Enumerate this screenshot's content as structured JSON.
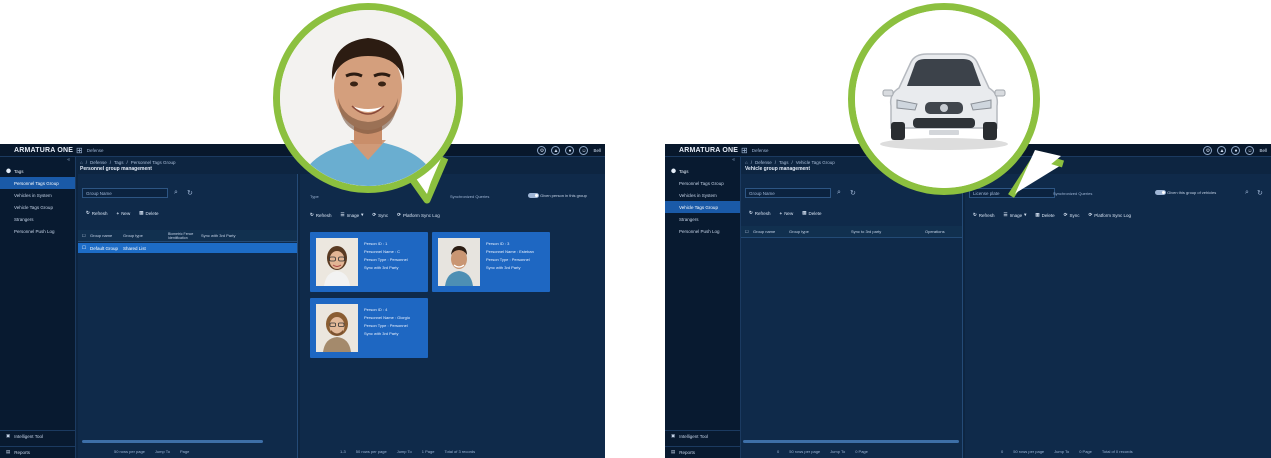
{
  "left_app": {
    "brand": "ARMATURA ONE",
    "top_crumb": "Defense",
    "user": "Bell",
    "sidebar": {
      "header": "Tags",
      "items": [
        "Personnel Tags Group",
        "Vehicles in System",
        "Vehicle Tags Group",
        "Strangers",
        "Personnel Push Log"
      ],
      "bottom": [
        "Intelligent Tool",
        "Reports"
      ]
    },
    "breadcrumb": [
      "Defense",
      "Tags",
      "Personnel Tags Group"
    ],
    "page_title": "Personnel group management",
    "search_placeholder": "Group Name",
    "toolbar": [
      "Refresh",
      "New",
      "Delete"
    ],
    "table_headers": [
      "Group name",
      "Group type",
      "Biometric Fence Identification",
      "Sync with 3rd Party"
    ],
    "row": {
      "name": "Default Group",
      "type": "Shared List"
    },
    "left_pager": {
      "per_page": "50 rows per page",
      "jump": "Jump To",
      "page": "Page"
    },
    "right_filters": {
      "type_label": "Type",
      "sync_label": "Synchronized Queries",
      "toggle_label": "Given person in this group"
    },
    "right_toolbar": [
      "Refresh",
      "Image",
      "Sync",
      "Platform Sync Log"
    ],
    "cards": [
      {
        "id": "Person ID : 1",
        "name": "Personnel Name : C",
        "type": "Person Type : Personnel",
        "sync": "Sync with 3rd Party"
      },
      {
        "id": "Person ID : 3",
        "name": "Personnel Name : Esteban",
        "type": "Person Type : Personnel",
        "sync": "Sync with 3rd Party"
      },
      {
        "id": "Person ID : 4",
        "name": "Personnel Name : Giorgio",
        "type": "Person Type : Personnel",
        "sync": "Sync with 3rd Party"
      }
    ],
    "right_pager": {
      "count": "1-3",
      "per_page": "50 rows per page",
      "jump": "Jump To",
      "page": "1 Page",
      "total": "Total of 3 records"
    }
  },
  "right_app": {
    "brand": "ARMATURA ONE",
    "top_crumb": "Defense",
    "user": "Bell",
    "sidebar": {
      "header": "Tags",
      "items": [
        "Personnel Tags Group",
        "Vehicles in System",
        "Vehicle Tags Group",
        "Strangers",
        "Personnel Push Log"
      ],
      "bottom": [
        "Intelligent Tool",
        "Reports"
      ]
    },
    "breadcrumb": [
      "Defense",
      "Tags",
      "Vehicle Tags Group"
    ],
    "page_title": "Vehicle group management",
    "search_placeholder": "Group Name",
    "toolbar": [
      "Refresh",
      "New",
      "Delete"
    ],
    "table_headers": [
      "Group name",
      "Group type",
      "Sync to 3rd party",
      "Operations"
    ],
    "right_filters": {
      "plate_placeholder": "License plate",
      "sync_label": "Synchronized Queries",
      "toggle_label": "Given this group of vehicles"
    },
    "right_toolbar": [
      "Refresh",
      "Image",
      "Delete",
      "Sync",
      "Platform Sync Log"
    ],
    "left_pager": {
      "count": "0",
      "per_page": "50 rows per page",
      "jump": "Jump To",
      "page": "0 Page"
    },
    "right_pager": {
      "count": "0",
      "per_page": "50 rows per page",
      "jump": "Jump To",
      "page": "0 Page",
      "total": "Total of 0 records"
    }
  },
  "colors": {
    "accent": "#1d6cc6",
    "ring": "#8cc03f",
    "bg": "#0d2541"
  }
}
